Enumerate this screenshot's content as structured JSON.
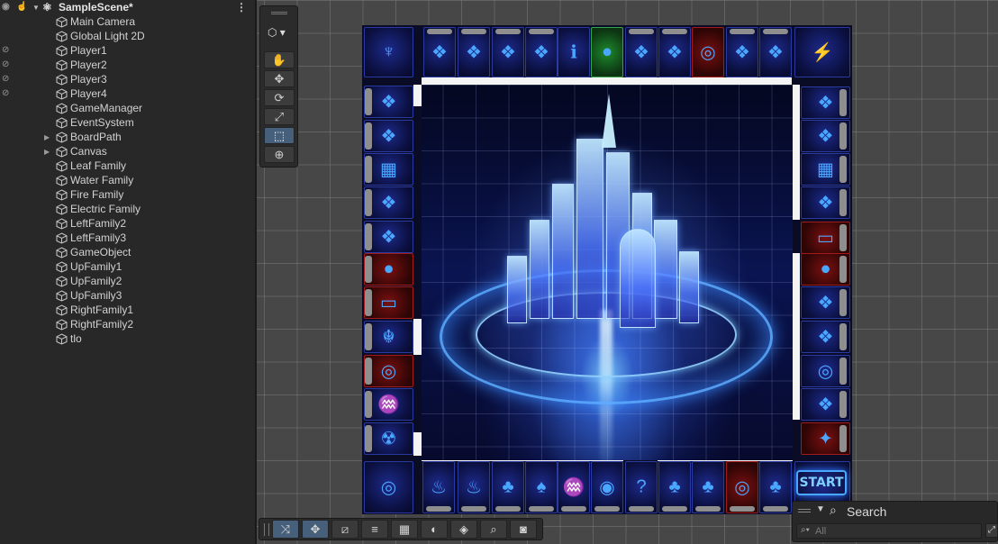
{
  "hierarchy": {
    "scene_name": "SampleScene*",
    "items": [
      {
        "label": "Main Camera",
        "hidden": false,
        "foldout": false
      },
      {
        "label": "Global Light 2D",
        "hidden": false,
        "foldout": false
      },
      {
        "label": "Player1",
        "hidden": true,
        "foldout": false
      },
      {
        "label": "Player2",
        "hidden": true,
        "foldout": false
      },
      {
        "label": "Player3",
        "hidden": true,
        "foldout": false
      },
      {
        "label": "Player4",
        "hidden": true,
        "foldout": false
      },
      {
        "label": "GameManager",
        "hidden": false,
        "foldout": false
      },
      {
        "label": "EventSystem",
        "hidden": false,
        "foldout": false
      },
      {
        "label": "BoardPath",
        "hidden": false,
        "foldout": true
      },
      {
        "label": "Canvas",
        "hidden": false,
        "foldout": true
      },
      {
        "label": "Leaf Family",
        "hidden": false,
        "foldout": false
      },
      {
        "label": "Water Family",
        "hidden": false,
        "foldout": false
      },
      {
        "label": "Fire Family",
        "hidden": false,
        "foldout": false
      },
      {
        "label": "Electric Family",
        "hidden": false,
        "foldout": false
      },
      {
        "label": "LeftFamily2",
        "hidden": false,
        "foldout": false
      },
      {
        "label": "LeftFamily3",
        "hidden": false,
        "foldout": false
      },
      {
        "label": "GameObject",
        "hidden": false,
        "foldout": false
      },
      {
        "label": "UpFamily1",
        "hidden": false,
        "foldout": false
      },
      {
        "label": "UpFamily2",
        "hidden": false,
        "foldout": false
      },
      {
        "label": "UpFamily3",
        "hidden": false,
        "foldout": false
      },
      {
        "label": "RightFamily1",
        "hidden": false,
        "foldout": false
      },
      {
        "label": "RightFamily2",
        "hidden": false,
        "foldout": false
      },
      {
        "label": "tlo",
        "hidden": false,
        "foldout": false
      }
    ]
  },
  "tools": {
    "items": [
      {
        "name": "hand-tool",
        "glyph": "✋"
      },
      {
        "name": "move-tool",
        "glyph": "✥"
      },
      {
        "name": "rotate-tool",
        "glyph": "⟳"
      },
      {
        "name": "scale-tool",
        "glyph": "⤢"
      },
      {
        "name": "rect-tool",
        "glyph": "⬚"
      },
      {
        "name": "transform-tool",
        "glyph": "⊕"
      }
    ],
    "active": "rect-tool"
  },
  "board": {
    "start_label": "START"
  },
  "bottom_toolbar": {
    "items": [
      {
        "name": "toggle-tool-handle-button",
        "glyph": "⤨"
      },
      {
        "name": "move-snap-button",
        "glyph": "✥"
      },
      {
        "name": "grid-snap-button",
        "glyph": "⧄"
      },
      {
        "name": "align-button",
        "glyph": "≡"
      },
      {
        "name": "grid-visibility-button",
        "glyph": "▦"
      },
      {
        "name": "shading-button",
        "glyph": "◐"
      },
      {
        "name": "layers-button",
        "glyph": "◈"
      },
      {
        "name": "zoom-button",
        "glyph": "⌕"
      },
      {
        "name": "gizmos-button",
        "glyph": "◙"
      }
    ]
  },
  "search_overlay": {
    "title": "Search",
    "placeholder": "All"
  }
}
